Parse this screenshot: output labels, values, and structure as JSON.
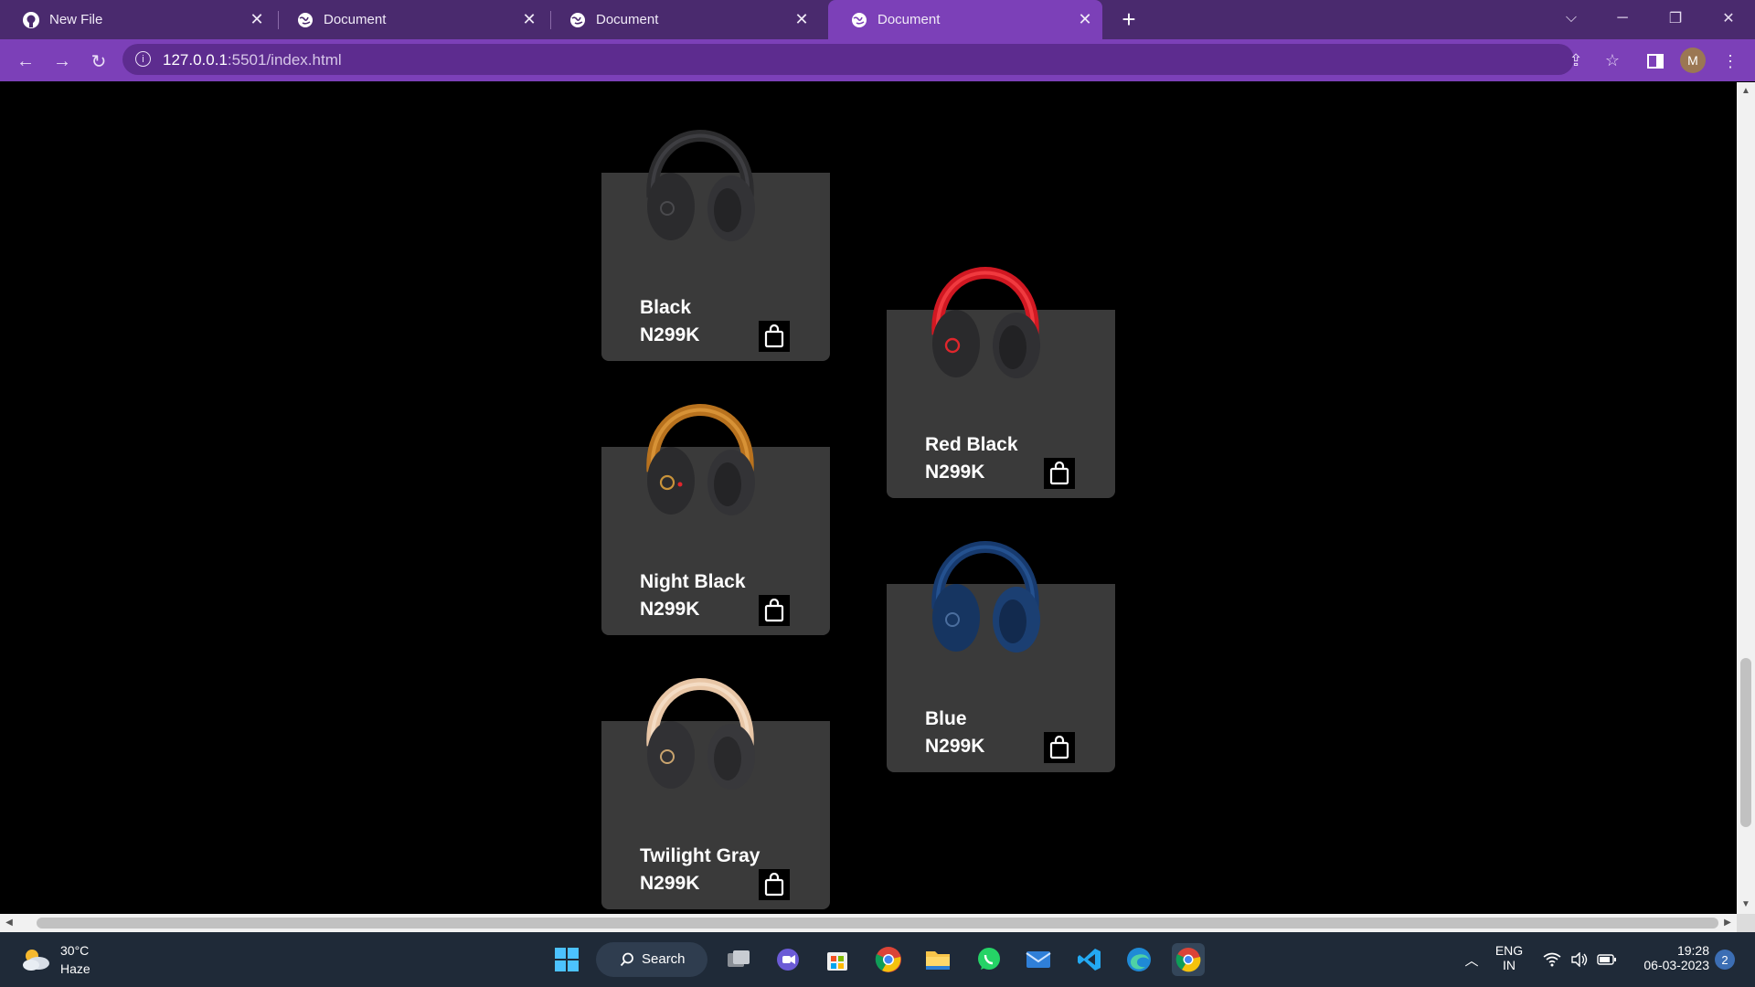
{
  "browser": {
    "tabs": [
      {
        "title": "New File",
        "favicon": "github-icon",
        "active": false
      },
      {
        "title": "Document",
        "favicon": "globe-icon",
        "active": false
      },
      {
        "title": "Document",
        "favicon": "globe-icon",
        "active": false
      },
      {
        "title": "Document",
        "favicon": "globe-icon",
        "active": true
      }
    ],
    "url_host": "127.0.0.1",
    "url_rest": ":5501/index.html",
    "profile_initial": "M",
    "theme_color": "#7c40b8"
  },
  "products": [
    {
      "name": "Black",
      "price": "N299K",
      "color": "black"
    },
    {
      "name": "Red Black",
      "price": "N299K",
      "color": "red-black"
    },
    {
      "name": "Night Black",
      "price": "N299K",
      "color": "night-black"
    },
    {
      "name": "Blue",
      "price": "N299K",
      "color": "blue"
    },
    {
      "name": "Twilight Gray",
      "price": "N299K",
      "color": "twilight-gray"
    }
  ],
  "taskbar": {
    "weather_temp": "30°C",
    "weather_desc": "Haze",
    "search_label": "Search",
    "lang_top": "ENG",
    "lang_bottom": "IN",
    "time": "19:28",
    "date": "06-03-2023",
    "notification_count": "2"
  }
}
